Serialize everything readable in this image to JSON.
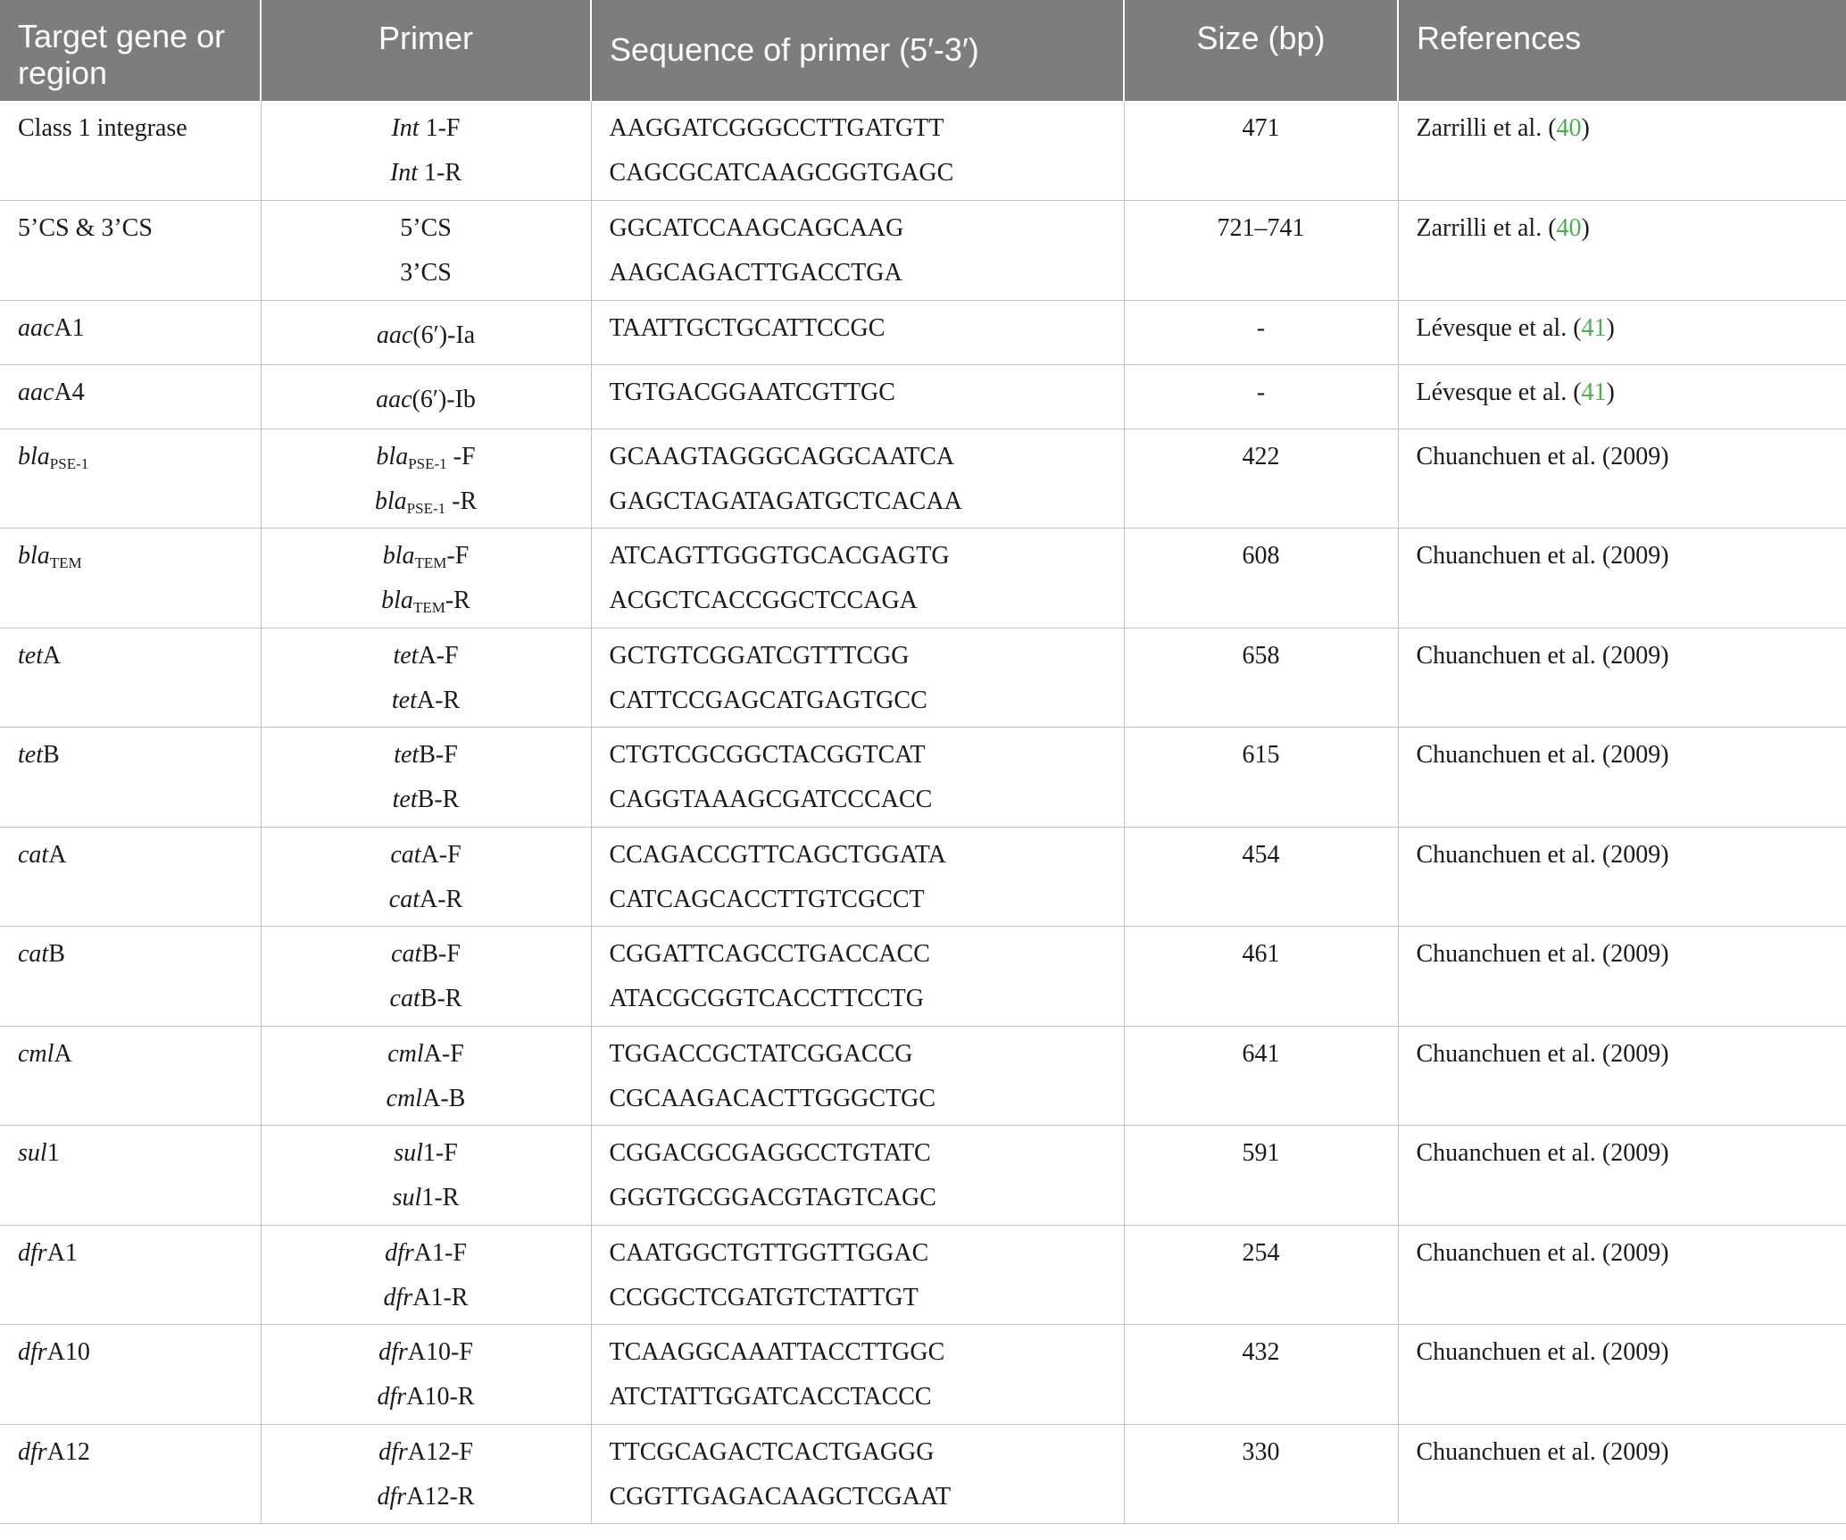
{
  "table": {
    "headers": [
      "Target gene or region",
      "Primer",
      "Sequence of primer (5′-3′)",
      "Size (bp)",
      "References"
    ],
    "rows": [
      {
        "gene": "Class 1 integrase",
        "primers": [
          "Int 1-F",
          "Int 1-R"
        ],
        "sequences": [
          "AAGGATCGGGCCTTGATGTT",
          "CAGCGCATCAAGCGGTGAGC"
        ],
        "size": "471",
        "ref_text": "Zarrilli et al. (",
        "ref_num": "40",
        "ref_close": ")"
      },
      {
        "gene": "5’CS & 3’CS",
        "primers": [
          "5’CS",
          "3’CS"
        ],
        "sequences": [
          "GGCATCCAAGCAGCAAG",
          "AAGCAGACTTGACCTGA"
        ],
        "size": "721–741",
        "ref_text": "Zarrilli et al. (",
        "ref_num": "40",
        "ref_close": ")"
      },
      {
        "gene": "aacA1",
        "primers": [
          "aac(6′)-Ia"
        ],
        "sequences": [
          "TAATTGCTGCATTCCGC"
        ],
        "size": "-",
        "ref_text": "Lévesque et al. (",
        "ref_num": "41",
        "ref_close": ")"
      },
      {
        "gene": "aacA4",
        "primers": [
          "aac(6′)-Ib"
        ],
        "sequences": [
          "TGTGACGGAATCGTTGC"
        ],
        "size": "-",
        "ref_text": "Lévesque et al. (",
        "ref_num": "41",
        "ref_close": ")"
      },
      {
        "gene": "blaPSE-1",
        "primers": [
          "blaPSE-1 -F",
          "blaPSE-1 -R"
        ],
        "sequences": [
          "GCAAGTAGGGCAGGCAATCA",
          "GAGCTAGATAGATGCTCACAA"
        ],
        "size": "422",
        "ref_text": "Chuanchuen et al. (2009)"
      },
      {
        "gene": "blaTEM",
        "primers": [
          "blaTEM-F",
          "blaTEM-R"
        ],
        "sequences": [
          "ATCAGTTGGGTGCACGAGTG",
          "ACGCTCACCGGCTCCAGA"
        ],
        "size": "608",
        "ref_text": "Chuanchuen et al. (2009)"
      },
      {
        "gene": "tetA",
        "primers": [
          "tetA-F",
          "tetA-R"
        ],
        "sequences": [
          "GCTGTCGGATCGTTTCGG",
          "CATTCCGAGCATGAGTGCC"
        ],
        "size": "658",
        "ref_text": "Chuanchuen et al. (2009)"
      },
      {
        "gene": "tetB",
        "primers": [
          "tetB-F",
          "tetB-R"
        ],
        "sequences": [
          "CTGTCGCGGCTACGGTCAT",
          "CAGGTAAAGCGATCCCACC"
        ],
        "size": "615",
        "ref_text": "Chuanchuen et al. (2009)"
      },
      {
        "gene": "catA",
        "primers": [
          "catA-F",
          "catA-R"
        ],
        "sequences": [
          "CCAGACCGTTCAGCTGGATA",
          "CATCAGCACCTTGTCGCCT"
        ],
        "size": "454",
        "ref_text": "Chuanchuen et al. (2009)"
      },
      {
        "gene": "catB",
        "primers": [
          "catB-F",
          "catB-R"
        ],
        "sequences": [
          "CGGATTCAGCCTGACCACC",
          "ATACGCGGTCACCTTCCTG"
        ],
        "size": "461",
        "ref_text": "Chuanchuen et al. (2009)"
      },
      {
        "gene": "cmlA",
        "primers": [
          "cmlA-F",
          "cmlA-B"
        ],
        "sequences": [
          "TGGACCGCTATCGGACCG",
          "CGCAAGACACTTGGGCTGC"
        ],
        "size": "641",
        "ref_text": "Chuanchuen et al. (2009)"
      },
      {
        "gene": "sul1",
        "primers": [
          "sul1-F",
          "sul1-R"
        ],
        "sequences": [
          "CGGACGCGAGGCCTGTATC",
          "GGGTGCGGACGTAGTCAGC"
        ],
        "size": "591",
        "ref_text": "Chuanchuen et al. (2009)"
      },
      {
        "gene": "dfrA1",
        "primers": [
          "dfrA1-F",
          "dfrA1-R"
        ],
        "sequences": [
          "CAATGGCTGTTGGTTGGAC",
          "CCGGCTCGATGTCTATTGT"
        ],
        "size": "254",
        "ref_text": "Chuanchuen et al. (2009)"
      },
      {
        "gene": "dfrA10",
        "primers": [
          "dfrA10-F",
          "dfrA10-R"
        ],
        "sequences": [
          "TCAAGGCAAATTACCTTGGC",
          "ATCTATTGGATCACCTACCC"
        ],
        "size": "432",
        "ref_text": "Chuanchuen et al. (2009)"
      },
      {
        "gene": "dfrA12",
        "primers": [
          "dfrA12-F",
          "dfrA12-R"
        ],
        "sequences": [
          "TTCGCAGACTCACTGAGGG",
          "CGGTTGAGACAAGCTCGAAT"
        ],
        "size": "330",
        "ref_text": "Chuanchuen et al. (2009)"
      }
    ],
    "colors": {
      "header_bg": "#7c7e7c",
      "header_text": "#ffffff",
      "ref_link": "#4caf50",
      "grid": "#c2c2c2"
    }
  }
}
